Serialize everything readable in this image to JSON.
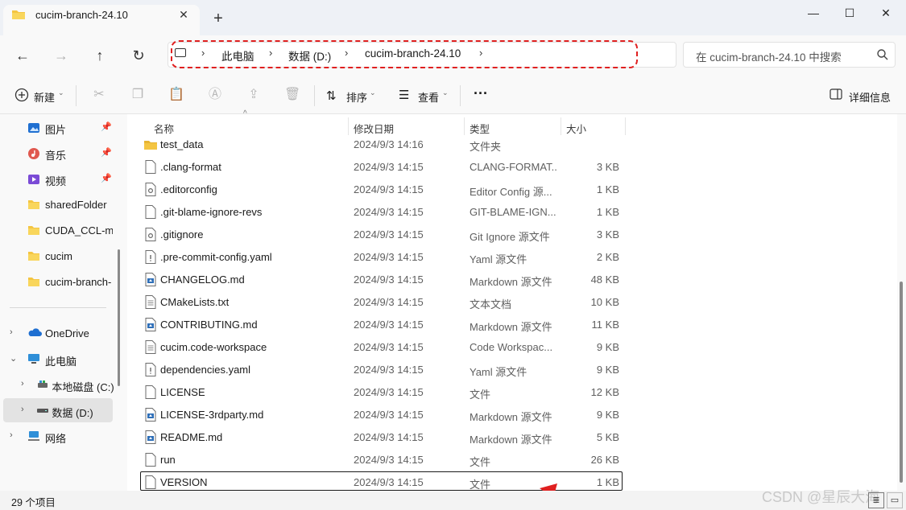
{
  "window": {
    "tab_title": "cucim-branch-24.10",
    "tab_close": "✕",
    "tab_add": "+",
    "minimize": "—",
    "maximize": "☐",
    "close": "✕"
  },
  "nav": {
    "back": "←",
    "forward": "→",
    "up": "↑",
    "refresh": "↻"
  },
  "breadcrumb": {
    "sep": "›",
    "items": [
      "此电脑",
      "数据 (D:)",
      "cucim-branch-24.10"
    ]
  },
  "search": {
    "placeholder": "在 cucim-branch-24.10 中搜索"
  },
  "toolbar": {
    "new_label": "新建",
    "sort_label": "排序",
    "view_label": "查看",
    "more": "···",
    "details_label": "详细信息",
    "chevron": "⌄"
  },
  "sidebar": {
    "quick": [
      {
        "label": "图片",
        "pinned": true
      },
      {
        "label": "音乐",
        "pinned": true
      },
      {
        "label": "视频",
        "pinned": true
      },
      {
        "label": "sharedFolder"
      },
      {
        "label": "CUDA_CCL-ma"
      },
      {
        "label": "cucim"
      },
      {
        "label": "cucim-branch-"
      }
    ],
    "tree": [
      {
        "label": "OneDrive",
        "exp": "›"
      },
      {
        "label": "此电脑",
        "exp": "⌄"
      },
      {
        "label": "本地磁盘 (C:)",
        "exp": "›"
      },
      {
        "label": "数据 (D:)",
        "exp": "›"
      },
      {
        "label": "网络",
        "exp": "›"
      }
    ],
    "pin": "📌"
  },
  "columns": {
    "name": "名称",
    "date": "修改日期",
    "type": "类型",
    "size": "大小",
    "sort_caret": "^"
  },
  "files": [
    {
      "name": "test_data",
      "date": "2024/9/3 14:16",
      "type": "文件夹",
      "size": "",
      "icon": "folder"
    },
    {
      "name": ".clang-format",
      "date": "2024/9/3 14:15",
      "type": "CLANG-FORMAT...",
      "size": "3 KB",
      "icon": "file"
    },
    {
      "name": ".editorconfig",
      "date": "2024/9/3 14:15",
      "type": "Editor Config 源...",
      "size": "1 KB",
      "icon": "gear"
    },
    {
      "name": ".git-blame-ignore-revs",
      "date": "2024/9/3 14:15",
      "type": "GIT-BLAME-IGN...",
      "size": "1 KB",
      "icon": "file"
    },
    {
      "name": ".gitignore",
      "date": "2024/9/3 14:15",
      "type": "Git Ignore 源文件",
      "size": "3 KB",
      "icon": "gear"
    },
    {
      "name": ".pre-commit-config.yaml",
      "date": "2024/9/3 14:15",
      "type": "Yaml 源文件",
      "size": "2 KB",
      "icon": "excl"
    },
    {
      "name": "CHANGELOG.md",
      "date": "2024/9/3 14:15",
      "type": "Markdown 源文件",
      "size": "48 KB",
      "icon": "md"
    },
    {
      "name": "CMakeLists.txt",
      "date": "2024/9/3 14:15",
      "type": "文本文档",
      "size": "10 KB",
      "icon": "text"
    },
    {
      "name": "CONTRIBUTING.md",
      "date": "2024/9/3 14:15",
      "type": "Markdown 源文件",
      "size": "11 KB",
      "icon": "md"
    },
    {
      "name": "cucim.code-workspace",
      "date": "2024/9/3 14:15",
      "type": "Code Workspac...",
      "size": "9 KB",
      "icon": "text"
    },
    {
      "name": "dependencies.yaml",
      "date": "2024/9/3 14:15",
      "type": "Yaml 源文件",
      "size": "9 KB",
      "icon": "excl"
    },
    {
      "name": "LICENSE",
      "date": "2024/9/3 14:15",
      "type": "文件",
      "size": "12 KB",
      "icon": "file"
    },
    {
      "name": "LICENSE-3rdparty.md",
      "date": "2024/9/3 14:15",
      "type": "Markdown 源文件",
      "size": "9 KB",
      "icon": "md"
    },
    {
      "name": "README.md",
      "date": "2024/9/3 14:15",
      "type": "Markdown 源文件",
      "size": "5 KB",
      "icon": "md"
    },
    {
      "name": "run",
      "date": "2024/9/3 14:15",
      "type": "文件",
      "size": "26 KB",
      "icon": "file"
    },
    {
      "name": "VERSION",
      "date": "2024/9/3 14:15",
      "type": "文件",
      "size": "1 KB",
      "icon": "file"
    }
  ],
  "status": {
    "count_text": "29 个项目",
    "view_details": "≣",
    "view_tiles": "▭"
  },
  "watermark": "CSDN @星辰大海",
  "colors": {
    "annotation_red": "#e02020",
    "folder_yellow": "#f4c542",
    "accent_blue": "#1f6fd1"
  }
}
